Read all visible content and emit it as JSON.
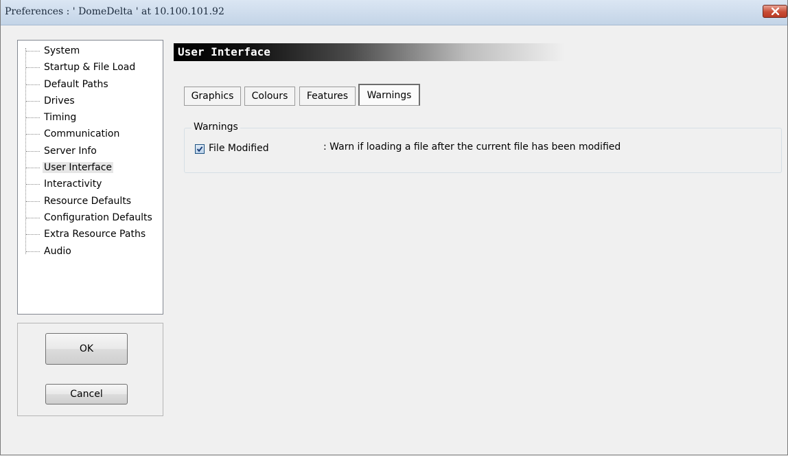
{
  "window": {
    "title": "Preferences  :  ' DomeDelta ' at 10.100.101.92"
  },
  "tree": {
    "selected": "User Interface",
    "items": [
      "System",
      "Startup & File Load",
      "Default Paths",
      "Drives",
      "Timing",
      "Communication",
      "Server Info",
      "User Interface",
      "Interactivity",
      "Resource Defaults",
      "Configuration Defaults",
      "Extra Resource Paths",
      "Audio"
    ]
  },
  "buttons": {
    "ok": "OK",
    "cancel": "Cancel"
  },
  "section": {
    "title": "User Interface"
  },
  "tabs": [
    {
      "label": "Graphics",
      "active": false
    },
    {
      "label": "Colours",
      "active": false
    },
    {
      "label": "Features",
      "active": false
    },
    {
      "label": "Warnings",
      "active": true
    }
  ],
  "warnings_group": {
    "legend": "Warnings",
    "options": [
      {
        "label": "File Modified",
        "checked": true,
        "description": ": Warn if loading a file after the current file has been modified"
      }
    ]
  },
  "colors": {
    "close_button": "#c84c35",
    "header_start": "#000000",
    "selected_item_bg": "#e6e6e6"
  }
}
